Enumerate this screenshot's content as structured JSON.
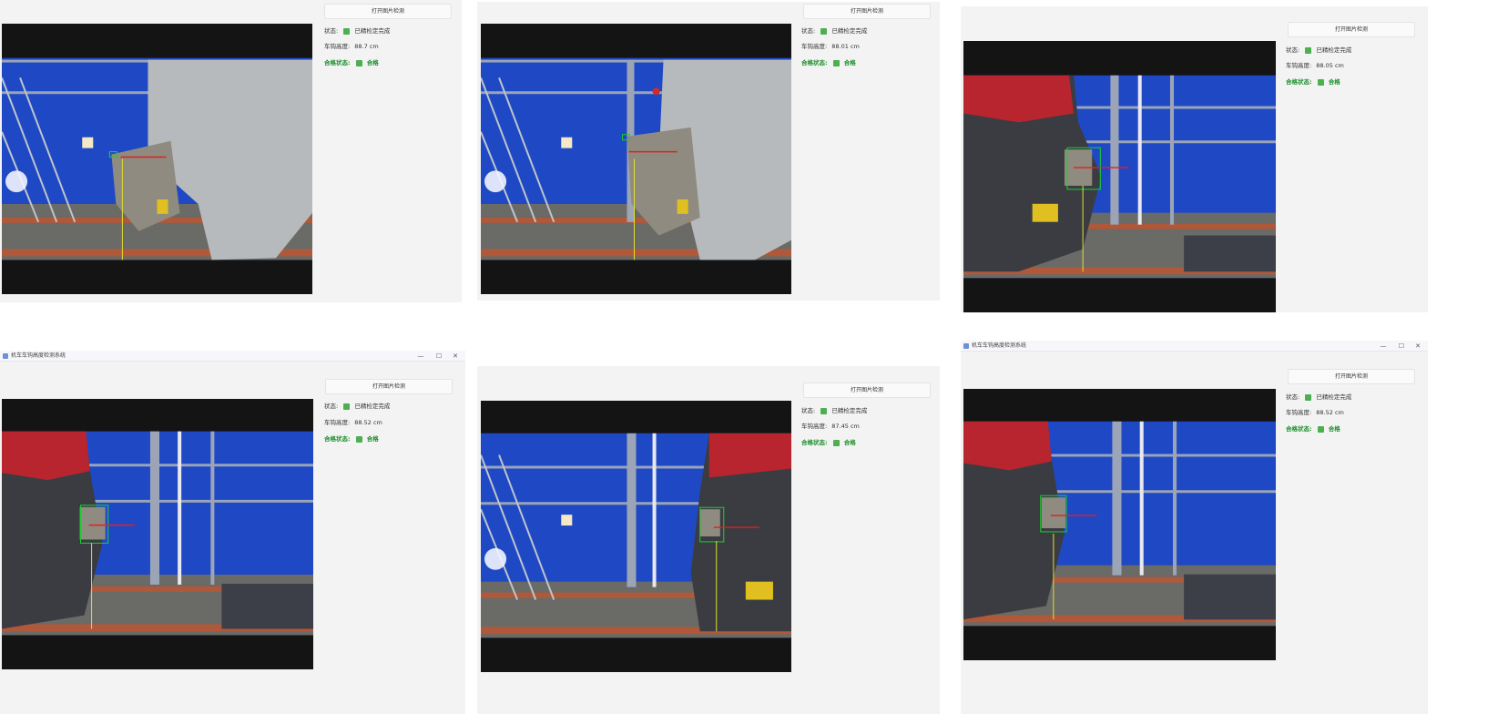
{
  "colors": {
    "panel_bg": "#f3f3f3",
    "status_square": "#4caf50",
    "qualified_text": "#1a8f2a",
    "wall_blue": "#1f49c4",
    "detect_box": "#19d22b",
    "measure_line": "#e02020",
    "height_line": "#e0e030"
  },
  "labels": {
    "start_button": "打开图片检测",
    "status_label": "状态:",
    "height_label": "车钩高度:",
    "qualified_label": "合格状态:",
    "qualified_value": "合格",
    "status_value": "已精检定完成"
  },
  "window": {
    "title": "机车车钩高度检测系统",
    "min_icon": "minimize-icon",
    "max_icon": "maximize-icon",
    "close_icon": "close-icon"
  },
  "panels": [
    {
      "height_value": "88.7 cm",
      "scene": "hopper"
    },
    {
      "height_value": "88.01 cm",
      "scene": "hopper"
    },
    {
      "height_value": "88.05 cm",
      "scene": "loco-left"
    },
    {
      "height_value": "88.52 cm",
      "scene": "loco-left"
    },
    {
      "height_value": "87.45 cm",
      "scene": "loco-right"
    },
    {
      "height_value": "88.52 cm",
      "scene": "loco-left"
    }
  ]
}
